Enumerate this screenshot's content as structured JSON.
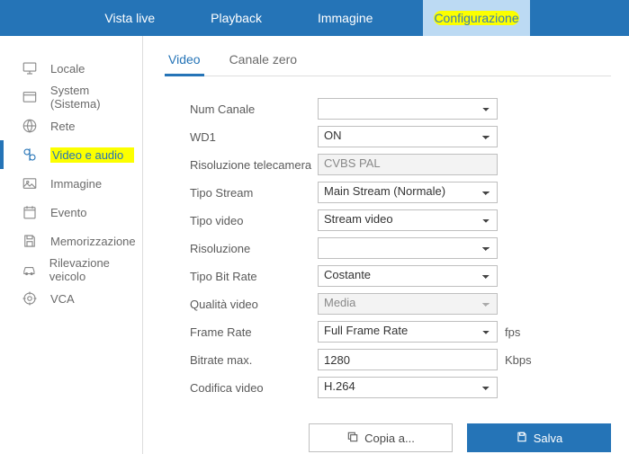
{
  "topnav": {
    "live": "Vista live",
    "playback": "Playback",
    "image": "Immagine",
    "config": "Configurazione"
  },
  "sidebar": {
    "local": "Locale",
    "system": "System (Sistema)",
    "network": "Rete",
    "videoaudio": "Video e audio",
    "image": "Immagine",
    "event": "Evento",
    "storage": "Memorizzazione",
    "vehicle": "Rilevazione veicolo",
    "vca": "VCA"
  },
  "tabs": {
    "video": "Video",
    "zero": "Canale zero"
  },
  "form": {
    "num_channel": {
      "label": "Num Canale",
      "value": ""
    },
    "wd1": {
      "label": "WD1",
      "value": "ON"
    },
    "cam_res": {
      "label": "Risoluzione telecamera",
      "value": "CVBS PAL"
    },
    "stream_type": {
      "label": "Tipo Stream",
      "value": "Main Stream (Normale)"
    },
    "video_type": {
      "label": "Tipo video",
      "value": "Stream video"
    },
    "resolution": {
      "label": "Risoluzione",
      "value": ""
    },
    "bitrate_type": {
      "label": "Tipo Bit Rate",
      "value": "Costante"
    },
    "video_quality": {
      "label": "Qualità video",
      "value": "Media"
    },
    "frame_rate": {
      "label": "Frame Rate",
      "value": "Full Frame Rate",
      "unit": "fps"
    },
    "bitrate_max": {
      "label": "Bitrate max.",
      "value": "1280",
      "unit": "Kbps"
    },
    "video_encoding": {
      "label": "Codifica video",
      "value": "H.264"
    }
  },
  "buttons": {
    "copy": "Copia a...",
    "save": "Salva"
  }
}
